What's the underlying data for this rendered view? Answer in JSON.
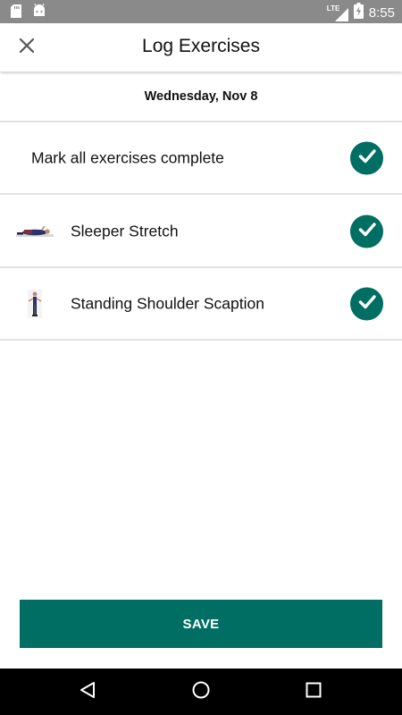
{
  "status_bar": {
    "network_label": "LTE",
    "time": "8:55",
    "icons": [
      "sd-card-icon",
      "android-icon",
      "signal-icon",
      "battery-icon"
    ]
  },
  "app_bar": {
    "title": "Log Exercises",
    "close_icon": "close-icon"
  },
  "date": "Wednesday, Nov 8",
  "mark_all": {
    "label": "Mark all exercises complete",
    "checked": true
  },
  "exercises": [
    {
      "name": "Sleeper Stretch",
      "checked": true,
      "thumbnail": "sleeper-stretch-thumbnail"
    },
    {
      "name": "Standing Shoulder Scaption",
      "checked": true,
      "thumbnail": "standing-shoulder-scaption-thumbnail"
    }
  ],
  "save_label": "SAVE",
  "colors": {
    "accent": "#006e63",
    "status_bar": "#8a8a8a",
    "nav_bar": "#000000",
    "divider": "#e2e2e2"
  },
  "nav_bar": {
    "icons": [
      "back-icon",
      "home-icon",
      "recents-icon"
    ]
  }
}
